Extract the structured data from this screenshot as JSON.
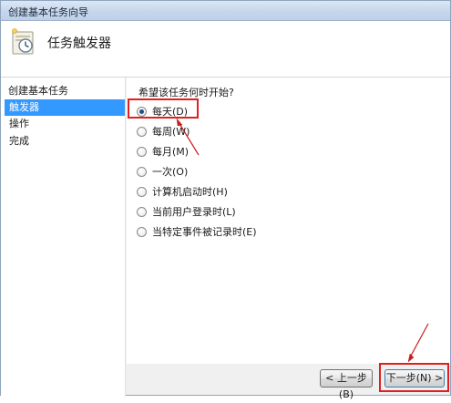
{
  "window": {
    "title": "创建基本任务向导"
  },
  "header": {
    "title": "任务触发器",
    "icon": "task-clock-icon"
  },
  "sidebar": {
    "heading": "创建基本任务",
    "items": [
      {
        "label": "触发器",
        "selected": true
      },
      {
        "label": "操作",
        "selected": false
      },
      {
        "label": "完成",
        "selected": false
      }
    ]
  },
  "main": {
    "question": "希望该任务何时开始?",
    "options": [
      {
        "label": "每天(D)",
        "checked": true
      },
      {
        "label": "每周(W)",
        "checked": false
      },
      {
        "label": "每月(M)",
        "checked": false
      },
      {
        "label": "一次(O)",
        "checked": false
      },
      {
        "label": "计算机启动时(H)",
        "checked": false
      },
      {
        "label": "当前用户登录时(L)",
        "checked": false
      },
      {
        "label": "当特定事件被记录时(E)",
        "checked": false
      }
    ]
  },
  "footer": {
    "prev_label": "< 上一步(B)",
    "next_label": "下一步(N) >"
  },
  "colors": {
    "annotation": "#e02020",
    "selection": "#3399ff"
  }
}
